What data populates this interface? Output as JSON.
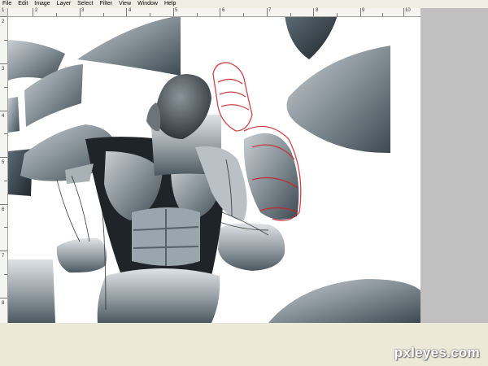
{
  "menu": {
    "items": [
      "File",
      "Edit",
      "Image",
      "Layer",
      "Select",
      "Filter",
      "View",
      "Window",
      "Help"
    ]
  },
  "ruler": {
    "horizontal_labels": [
      "1",
      "2",
      "3",
      "4",
      "5",
      "6",
      "7",
      "8",
      "9",
      "10",
      "11"
    ],
    "vertical_labels": [
      "2",
      "3",
      "4",
      "5",
      "6",
      "7",
      "8",
      "9"
    ]
  },
  "canvas": {
    "background": "#ffffff",
    "pasteboard_color": "#c0c0c0",
    "accent_sketch_color": "#c8242a"
  },
  "watermark": {
    "text": "pxleyes.com"
  }
}
